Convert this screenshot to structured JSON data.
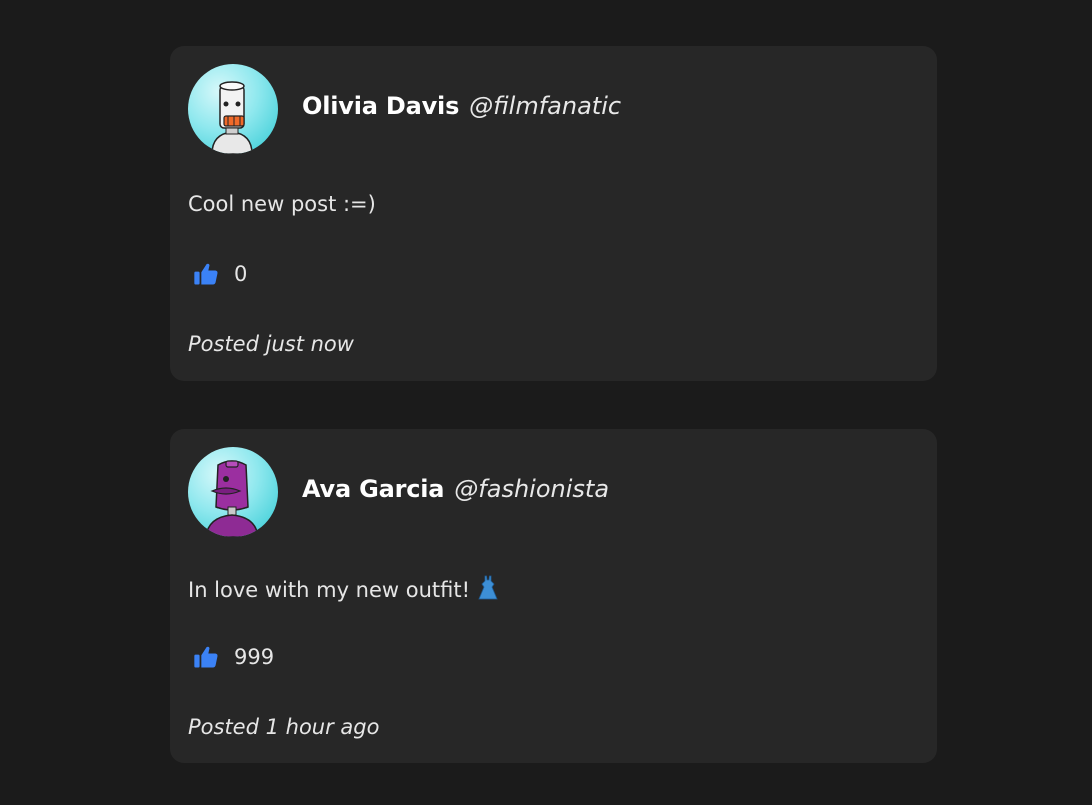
{
  "posts": [
    {
      "author_name": "Olivia Davis",
      "handle": "@filmfanatic",
      "avatar_icon": "robot-avatar-white",
      "text": "Cool new post :=)",
      "like_icon": "thumbs-up-icon",
      "likes": "0",
      "timestamp": "Posted just now"
    },
    {
      "author_name": "Ava Garcia",
      "handle": "@fashionista",
      "avatar_icon": "robot-avatar-purple",
      "text": "In love with my new outfit!",
      "emoji_icon": "dress-emoji-icon",
      "like_icon": "thumbs-up-icon",
      "likes": "999",
      "timestamp": "Posted 1 hour ago"
    }
  ],
  "colors": {
    "background": "#1b1b1b",
    "card": "#272727",
    "like_blue": "#3b82f6",
    "avatar_teal": "#2ec9d3"
  }
}
